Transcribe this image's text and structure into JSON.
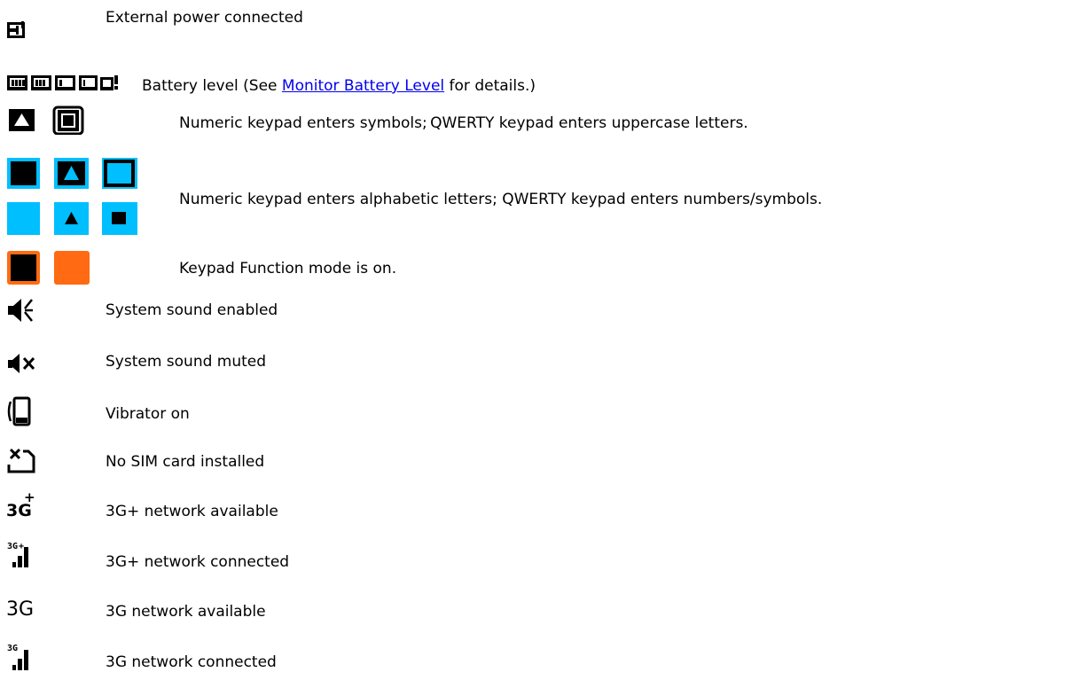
{
  "rows": [
    {
      "label": "External power connected",
      "icon": "power-plug-icon"
    },
    {
      "label_before": "Battery level (See ",
      "link": "Monitor Battery Level",
      "label_after": " for details.)",
      "icon": "battery-level-icons"
    },
    {
      "label": "Numeric keypad enters symbols; QWERTY keypad enters uppercase letters.",
      "icon": "keypad-shift-icons"
    },
    {
      "label": "Numeric keypad enters alphabetic letters; QWERTY keypad enters numbers/symbols.",
      "icon": "keypad-alpha-icons"
    },
    {
      "label": "Keypad Function mode is on.",
      "icon": "keypad-function-icons"
    },
    {
      "label": "System sound enabled",
      "icon": "speaker-on-icon"
    },
    {
      "label": "System sound muted",
      "icon": "speaker-muted-icon"
    },
    {
      "label": "Vibrator on",
      "icon": "vibrate-icon"
    },
    {
      "label": "No SIM card installed",
      "icon": "no-sim-icon"
    },
    {
      "label": "3G+ network available",
      "icon": "3g-plus-icon"
    },
    {
      "label": "3G+ network connected",
      "icon": "3g-plus-signal-icon"
    },
    {
      "label": "3G network available",
      "icon": "3g-icon"
    },
    {
      "label": "3G network connected",
      "icon": "3g-signal-icon"
    }
  ],
  "icon_text": {
    "three_g_plus": "3G",
    "plus": "+",
    "three_g": "3G"
  },
  "colors": {
    "cyan": "#00bfff",
    "orange": "#ff6a13",
    "black": "#000000",
    "link": "#0000ee"
  }
}
